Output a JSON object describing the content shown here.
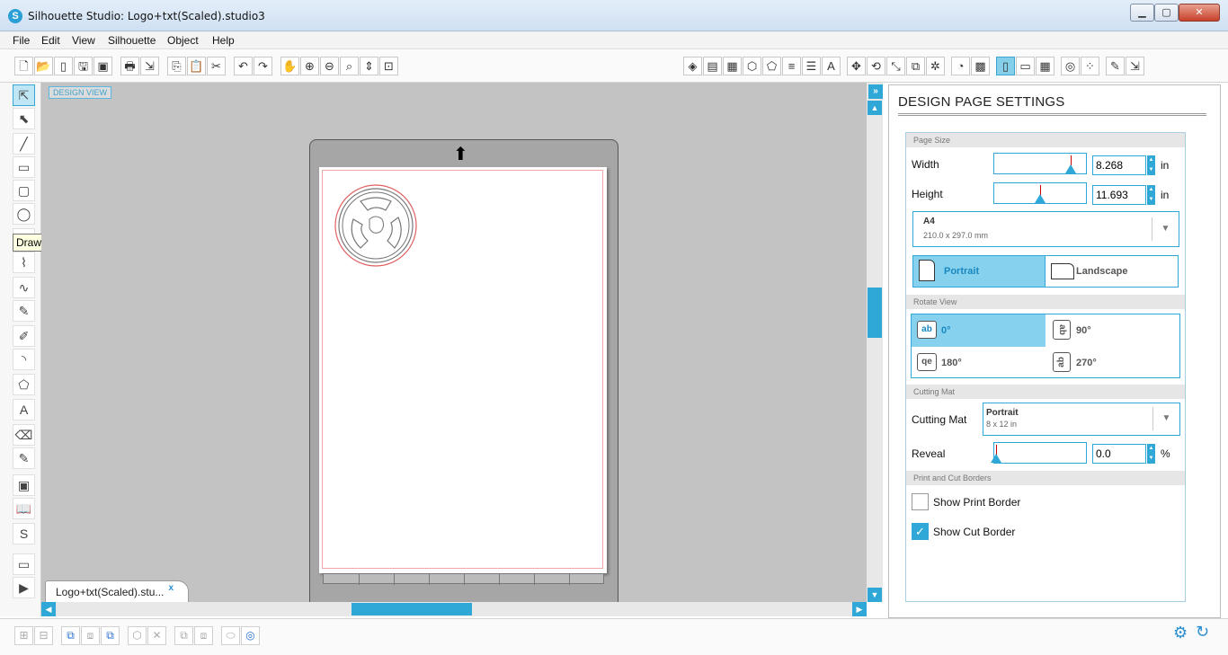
{
  "window": {
    "title": "Silhouette Studio: Logo+txt(Scaled).studio3",
    "app_icon": "silhouette-logo-icon",
    "min_glyph": "▁",
    "max_glyph": "▢",
    "close_glyph": "✕"
  },
  "menu": [
    "File",
    "Edit",
    "View",
    "Silhouette",
    "Object",
    "Help"
  ],
  "toolbar_left": [
    {
      "icon": "new-icon",
      "glyph": "🗋"
    },
    {
      "icon": "open-icon",
      "glyph": "📂"
    },
    {
      "icon": "open-template-icon",
      "glyph": "▯"
    },
    {
      "icon": "save-icon",
      "glyph": "🖫"
    },
    {
      "icon": "save-library-icon",
      "glyph": "▣"
    },
    {
      "icon": "print-icon",
      "glyph": "🖶"
    },
    {
      "icon": "send-to-silhouette-icon",
      "glyph": "⇲"
    },
    {
      "icon": "copy-icon",
      "glyph": "⎘"
    },
    {
      "icon": "paste-icon",
      "glyph": "📋"
    },
    {
      "icon": "cut-icon",
      "glyph": "✂"
    },
    {
      "icon": "undo-icon",
      "glyph": "↶"
    },
    {
      "icon": "redo-icon",
      "glyph": "↷"
    },
    {
      "icon": "pan-hand-icon",
      "glyph": "✋"
    },
    {
      "icon": "zoom-in-icon",
      "glyph": "⊕"
    },
    {
      "icon": "zoom-out-icon",
      "glyph": "⊖"
    },
    {
      "icon": "zoom-select-icon",
      "glyph": "⌕"
    },
    {
      "icon": "zoom-drag-icon",
      "glyph": "⇕"
    },
    {
      "icon": "fit-to-window-icon",
      "glyph": "⊡"
    }
  ],
  "toolbar_right": [
    {
      "icon": "fill-color-icon",
      "glyph": "◈"
    },
    {
      "icon": "fill-gradient-icon",
      "glyph": "▤"
    },
    {
      "icon": "fill-pattern-icon",
      "glyph": "▦"
    },
    {
      "icon": "line-color-icon",
      "glyph": "⬡"
    },
    {
      "icon": "line-style-icon",
      "glyph": "⬠"
    },
    {
      "icon": "line-palette-icon",
      "glyph": "≡"
    },
    {
      "icon": "line-style-dash-icon",
      "glyph": "☰"
    },
    {
      "icon": "text-style-icon",
      "glyph": "A"
    },
    {
      "icon": "transform-icon",
      "glyph": "✥"
    },
    {
      "icon": "rotate-icon",
      "glyph": "⟲"
    },
    {
      "icon": "scale-icon",
      "glyph": "⤡"
    },
    {
      "icon": "replicate-icon",
      "glyph": "⧉"
    },
    {
      "icon": "modify-icon",
      "glyph": "✲"
    },
    {
      "icon": "library-icon",
      "glyph": "◔"
    },
    {
      "icon": "store-icon",
      "glyph": "▩"
    },
    {
      "icon": "page-settings-icon",
      "glyph": "▯",
      "active": true
    },
    {
      "icon": "cut-settings-icon",
      "glyph": "▭"
    },
    {
      "icon": "grid-icon",
      "glyph": "▦"
    },
    {
      "icon": "registration-marks-icon",
      "glyph": "◎"
    },
    {
      "icon": "trace-icon",
      "glyph": "⁘"
    },
    {
      "icon": "knife-icon",
      "glyph": "✎"
    },
    {
      "icon": "send-icon",
      "glyph": "⇲"
    }
  ],
  "left_tools": [
    {
      "icon": "select-arrow-icon",
      "glyph": "⇱",
      "active": true
    },
    {
      "icon": "edit-points-icon",
      "glyph": "⬉"
    },
    {
      "icon": "draw-line-icon",
      "glyph": "╱"
    },
    {
      "icon": "draw-rectangle-icon",
      "glyph": "▭"
    },
    {
      "icon": "draw-rounded-rectangle-icon",
      "glyph": "▢"
    },
    {
      "icon": "draw-ellipse-icon",
      "glyph": "◯"
    },
    {
      "icon": "draw-polygon-icon",
      "glyph": "⬠"
    },
    {
      "icon": "draw-curve-icon",
      "glyph": "⌇"
    },
    {
      "icon": "draw-polygon-tool-icon",
      "glyph": "∿"
    },
    {
      "icon": "freehand-icon",
      "glyph": "✎"
    },
    {
      "icon": "smooth-freehand-icon",
      "glyph": "✐"
    },
    {
      "icon": "arc-icon",
      "glyph": "◝"
    },
    {
      "icon": "regular-polygon-icon",
      "glyph": "⬠"
    },
    {
      "icon": "text-tool-icon",
      "glyph": "A"
    },
    {
      "icon": "eraser-icon",
      "glyph": "⌫"
    },
    {
      "icon": "knife-tool-icon",
      "glyph": "✎"
    },
    {
      "icon": "design-view-icon",
      "glyph": "▣"
    },
    {
      "icon": "library-book-icon",
      "glyph": "📖"
    },
    {
      "icon": "silhouette-store-icon",
      "glyph": "S"
    },
    {
      "icon": "window-icon",
      "glyph": "▭"
    },
    {
      "icon": "play-icon",
      "glyph": "▶"
    }
  ],
  "tooltip": "Draw an Ellipse",
  "canvas": {
    "design_view_label": "DESIGN VIEW",
    "mat_arrow_glyph": "⬆"
  },
  "doc_tab": {
    "label": "Logo+txt(Scaled).stu...",
    "close": "x"
  },
  "scroll_glyphs": {
    "up": "▲",
    "down": "▼",
    "left": "◀",
    "right": "▶",
    "collapse": "»"
  },
  "panel": {
    "title": "DESIGN PAGE SETTINGS",
    "page_size": {
      "header": "Page Size",
      "width_label": "Width",
      "width_value": "8.268",
      "width_fraction": 0.83,
      "height_label": "Height",
      "height_value": "11.693",
      "height_fraction": 0.5,
      "unit": "in",
      "preset_name": "A4",
      "preset_dims": "210.0 x 297.0 mm",
      "portrait_label": "Portrait",
      "landscape_label": "Landscape",
      "orientation": "Portrait"
    },
    "rotate_view": {
      "header": "Rotate View",
      "options": [
        {
          "label": "0°",
          "glyph": "ab",
          "active": true
        },
        {
          "label": "90°",
          "glyph": "ab"
        },
        {
          "label": "180°",
          "glyph": "qe"
        },
        {
          "label": "270°",
          "glyph": "ab"
        }
      ]
    },
    "cutting_mat": {
      "header": "Cutting Mat",
      "label": "Cutting Mat",
      "value": "Portrait",
      "sub": "8 x 12 in",
      "reveal_label": "Reveal",
      "reveal_value": "0.0",
      "reveal_fraction": 0.0,
      "reveal_unit": "%"
    },
    "borders": {
      "header": "Print and Cut Borders",
      "print_label": "Show Print Border",
      "print_checked": false,
      "cut_label": "Show Cut Border",
      "cut_checked": true,
      "check_glyph": "✓"
    }
  },
  "bottom_tools": [
    {
      "icon": "group-icon",
      "glyph": "⊞"
    },
    {
      "icon": "ungroup-icon",
      "glyph": "⊟"
    },
    {
      "icon": "make-compound-icon",
      "glyph": "⧉",
      "active": true
    },
    {
      "icon": "release-compound-icon",
      "glyph": "⧈"
    },
    {
      "icon": "bring-forward-icon",
      "glyph": "⧉",
      "active": true
    },
    {
      "icon": "weld-icon",
      "glyph": "⬡"
    },
    {
      "icon": "delete-icon",
      "glyph": "✕"
    },
    {
      "icon": "duplicate-icon",
      "glyph": "⧉"
    },
    {
      "icon": "arrange-icon",
      "glyph": "⧈"
    },
    {
      "icon": "offset-icon",
      "glyph": "⬭"
    },
    {
      "icon": "trace-bottom-icon",
      "glyph": "◎",
      "active": true
    }
  ],
  "status": {
    "gear": "⚙",
    "refresh": "↻"
  },
  "colors": {
    "accent": "#2fa8d8",
    "active_fill": "#86d2ee",
    "cut_line": "#e06060"
  }
}
